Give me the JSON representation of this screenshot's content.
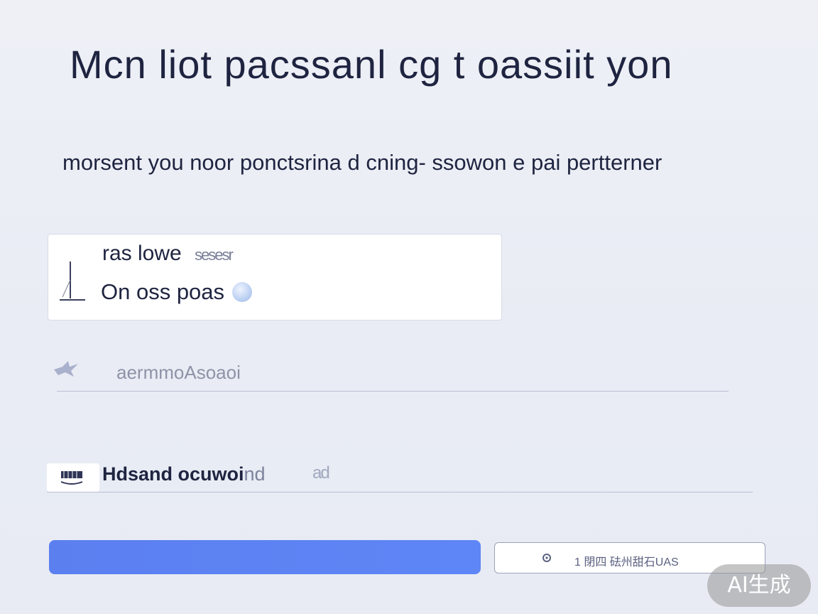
{
  "header": {
    "title": "Mcn liot pacssanl cg t oassiit yon",
    "subtitle": "morsent you noor ponctsrina d cning- ssowon e pai pertterner"
  },
  "card": {
    "line1_label": "ras lowe",
    "line1_faded": "sesesr",
    "line2_label": "On oss poas",
    "icon": "stand-icon",
    "badge_icon": "sphere-icon"
  },
  "field_one": {
    "icon": "bird-icon",
    "placeholder": "aermmoAsoaoi"
  },
  "field_two": {
    "icon": "keyboard-icon",
    "label": "Hdsand ocuwoi",
    "label_tail": "nd",
    "extra": "ad"
  },
  "actions": {
    "primary_label": "",
    "secondary_icon": "gear-icon",
    "secondary_label": "1 閉四 砝州甜石UAS"
  },
  "watermark": {
    "text": "AI生成"
  },
  "colors": {
    "accent": "#5c7ff0",
    "background": "#eef0f6",
    "text": "#1e2440"
  }
}
